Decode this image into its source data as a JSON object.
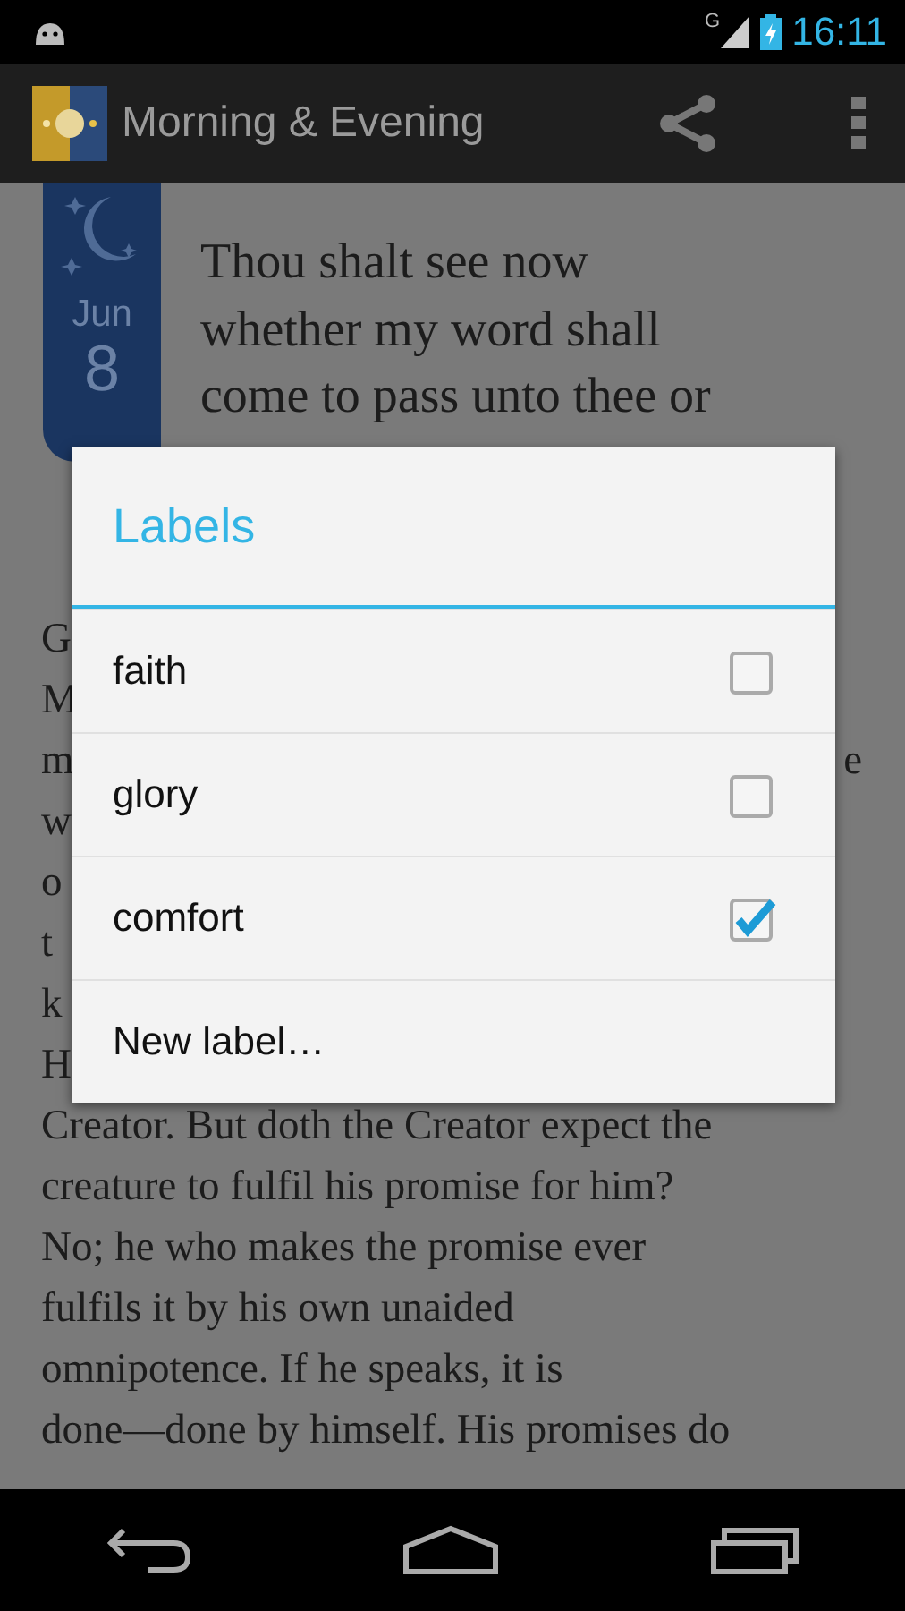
{
  "status_bar": {
    "network": "G",
    "time": "16:11"
  },
  "action_bar": {
    "title": "Morning & Evening"
  },
  "entry": {
    "month": "Jun",
    "day": "8",
    "heading": [
      "Thou shalt see now",
      "whether my word shall",
      "come to pass unto thee or"
    ],
    "lines": [
      {
        "text": "G"
      },
      {
        "text": "M"
      },
      {
        "text": "m",
        "end": "e"
      },
      {
        "text": "w"
      },
      {
        "text": "o"
      },
      {
        "text": "t"
      },
      {
        "text": "k"
      },
      {
        "text": "H"
      },
      {
        "text": "Creator. But doth the Creator expect the"
      },
      {
        "text": "creature to fulfil his promise for him?"
      },
      {
        "text": "No; he who makes the promise ever"
      },
      {
        "text": "fulfils it by his own unaided"
      },
      {
        "text": "omnipotence. If he speaks, it is"
      },
      {
        "text": "done—done by himself. His promises do"
      }
    ]
  },
  "dialog": {
    "title": "Labels",
    "items": [
      {
        "label": "faith",
        "checked": false
      },
      {
        "label": "glory",
        "checked": false
      },
      {
        "label": "comfort",
        "checked": true
      }
    ],
    "new_label": "New label…"
  }
}
